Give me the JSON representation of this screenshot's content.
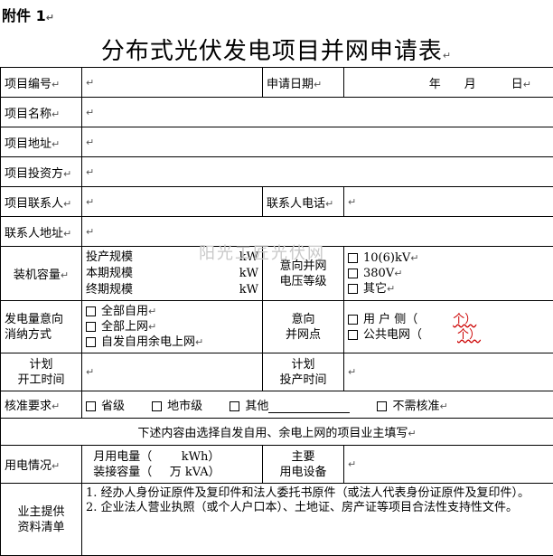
{
  "header": {
    "attachment": "附件 1",
    "title": "分布式光伏发电项目并网申请表"
  },
  "watermark": "阳光工匠光伏网",
  "rows": {
    "project_no": "项目编号",
    "apply_date": "申请日期",
    "date_parts": {
      "year": "年",
      "month": "月",
      "day": "日"
    },
    "project_name": "项目名称",
    "project_addr": "项目地址",
    "investor": "项目投资方",
    "contact": "项目联系人",
    "contact_phone": "联系人电话",
    "contact_addr": "联系人地址",
    "capacity_label": "装机容量",
    "capacity_items": [
      {
        "label": "投产规模",
        "unit": "kW"
      },
      {
        "label": "本期规模",
        "unit": "kW"
      },
      {
        "label": "终期规模",
        "unit": "kW"
      }
    ],
    "voltage_label_1": "意向并网",
    "voltage_label_2": "电压等级",
    "voltage_options": [
      "10(6)kV",
      "380V",
      "其它"
    ],
    "consume_label_1": "发电量意向",
    "consume_label_2": "消纳方式",
    "consume_options": [
      "全部自用",
      "全部上网",
      "自发自用余电上网"
    ],
    "point_label_1": "意向",
    "point_label_2": "并网点",
    "point_options": [
      {
        "label": "用 户 侧（",
        "unit": "个）"
      },
      {
        "label": "公共电网（",
        "unit": "个）"
      }
    ],
    "start_label_1": "计划",
    "start_label_2": "开工时间",
    "op_label_1": "计划",
    "op_label_2": "投产时间",
    "approval_label": "核准要求",
    "approval_options": [
      "省级",
      "地市级",
      "其他",
      "不需核准"
    ],
    "note": "下述内容由选择自发自用、余电上网的项目业主填写",
    "usage_label": "用电情况",
    "usage_items": [
      {
        "label": "月用电量（",
        "unit": "kWh）"
      },
      {
        "label": "装接容量（",
        "unit": "万 kVA）"
      }
    ],
    "equip_label_1": "主要",
    "equip_label_2": "用电设备",
    "docs_label_1": "业主提供",
    "docs_label_2": "资料清单",
    "docs": [
      "1. 经办人身份证原件及复印件和法人委托书原件（或法人代表身份证原件及复印件）。",
      "2. 企业法人营业执照（或个人户口本）、土地证、房产证等项目合法性支持性文件。"
    ]
  }
}
